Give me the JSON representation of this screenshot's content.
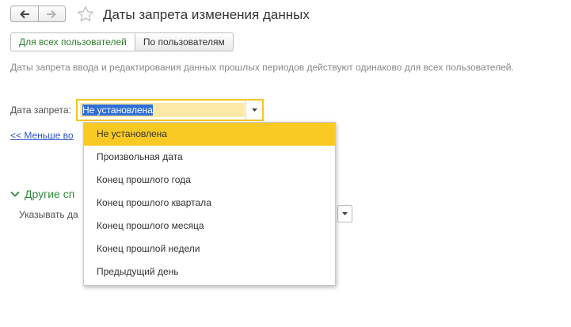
{
  "window": {
    "title": "Даты запрета изменения данных"
  },
  "tabs": [
    {
      "label": "Для всех пользователей"
    },
    {
      "label": "По пользователям"
    }
  ],
  "info_text": "Даты запрета ввода и редактирования данных прошлых периодов действуют одинаково для всех пользователей.",
  "field": {
    "label": "Дата запрета:",
    "value": "Не установлена"
  },
  "less_link": "<< Меньше во",
  "group": {
    "header": "Другие сп",
    "indicate_label": "Указывать да"
  },
  "dropdown": {
    "selected_index": 0,
    "options": [
      "Не установлена",
      "Произвольная дата",
      "Конец прошлого года",
      "Конец прошлого квартала",
      "Конец прошлого месяца",
      "Конец прошлой недели",
      "Предыдущий день"
    ]
  },
  "icons": {
    "back": "arrow-left-icon",
    "forward": "arrow-right-icon",
    "favorite": "star-icon",
    "dropdown": "chevron-down-icon",
    "collapse": "chevron-down-icon"
  },
  "colors": {
    "accent_yellow": "#f9ca24",
    "group_green": "#2f8a3a",
    "link_blue": "#2b55c8"
  }
}
